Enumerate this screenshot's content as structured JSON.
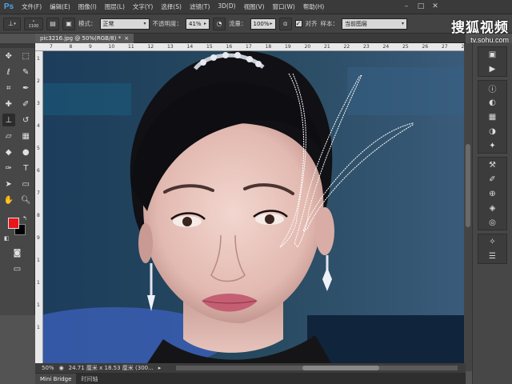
{
  "app": {
    "logo": "Ps"
  },
  "menu": [
    "文件(F)",
    "编辑(E)",
    "图像(I)",
    "图层(L)",
    "文字(Y)",
    "选择(S)",
    "滤镜(T)",
    "3D(D)",
    "视图(V)",
    "窗口(W)",
    "帮助(H)"
  ],
  "window_controls": {
    "minimize": "–",
    "maximize": "□",
    "close": "✕"
  },
  "options": {
    "brush_size": "1100",
    "mode_label": "模式：",
    "mode_value": "正常",
    "opacity_label": "不透明度：",
    "opacity_value": "41%",
    "flow_label": "流量：",
    "flow_value": "100%",
    "align_label": "对齐",
    "sample_label": "样本：",
    "sample_value": "当前图层"
  },
  "watermark": {
    "logo": "搜狐视频",
    "url": "tv.sohu.com"
  },
  "document": {
    "tab_title": "pic3216.jpg @ 50%(RGB/8) *",
    "close": "×"
  },
  "status": {
    "zoom": "50%",
    "doc_info": "24.71 厘米 x 18.53 厘米 (300..."
  },
  "bottom_tabs": [
    "Mini Bridge",
    "时间轴"
  ],
  "ruler_top": [
    "7",
    "8",
    "9",
    "10",
    "11",
    "12",
    "13",
    "14",
    "15",
    "16",
    "17",
    "18",
    "19",
    "20",
    "21",
    "22",
    "23",
    "24",
    "25",
    "26",
    "27",
    "28"
  ],
  "ruler_left": [
    "1",
    "2",
    "3",
    "4",
    "5",
    "6",
    "7",
    "8",
    "9",
    "1",
    "1",
    "1",
    "1"
  ],
  "colors": {
    "foreground": "#e8161b",
    "background": "#000000",
    "canvas_bg": "#24385e"
  },
  "tools": [
    [
      "move-icon",
      "marquee-icon"
    ],
    [
      "lasso-icon",
      "quick-select-icon"
    ],
    [
      "crop-icon",
      "eyedropper-icon"
    ],
    [
      "healing-icon",
      "brush-icon"
    ],
    [
      "clone-stamp-icon",
      "history-brush-icon"
    ],
    [
      "eraser-icon",
      "gradient-icon"
    ],
    [
      "blur-icon",
      "dodge-icon"
    ],
    [
      "pen-icon",
      "type-icon"
    ],
    [
      "path-select-icon",
      "shape-icon"
    ],
    [
      "hand-icon",
      "zoom-icon"
    ]
  ],
  "right_panel_icons": [
    "history-icon",
    "actions-icon",
    "info-icon",
    "color-icon",
    "swatches-icon",
    "adjustments-icon",
    "styles-icon",
    "tool-presets-icon",
    "brush-icon",
    "clone-source-icon",
    "layers-icon",
    "channels-icon",
    "paths-icon",
    "notes-icon"
  ]
}
